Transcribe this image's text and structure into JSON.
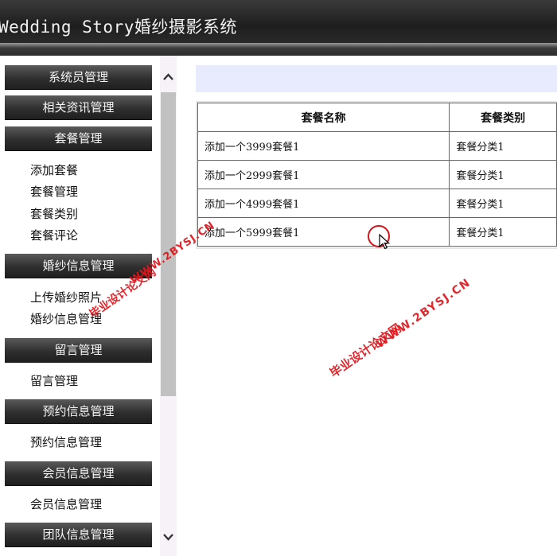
{
  "header": {
    "title": "Wedding Story婚纱摄影系统"
  },
  "sidebar": {
    "menus": [
      {
        "label": "系统员管理",
        "items": []
      },
      {
        "label": "相关资讯管理",
        "items": []
      },
      {
        "label": "套餐管理",
        "items": [
          "添加套餐",
          "套餐管理",
          "套餐类别",
          "套餐评论"
        ]
      },
      {
        "label": "婚纱信息管理",
        "items": [
          "上传婚纱照片",
          "婚纱信息管理"
        ]
      },
      {
        "label": "留言管理",
        "items": [
          "留言管理"
        ]
      },
      {
        "label": "预约信息管理",
        "items": [
          "预约信息管理"
        ]
      },
      {
        "label": "会员信息管理",
        "items": [
          "会员信息管理"
        ]
      },
      {
        "label": "团队信息管理",
        "items": []
      }
    ]
  },
  "table": {
    "headers": [
      "套餐名称",
      "套餐类别"
    ],
    "rows": [
      [
        "添加一个3999套餐1",
        "套餐分类1"
      ],
      [
        "添加一个2999套餐1",
        "套餐分类1"
      ],
      [
        "添加一个4999套餐1",
        "套餐分类1"
      ],
      [
        "添加一个5999套餐1",
        "套餐分类1"
      ]
    ]
  },
  "watermark": {
    "line1": "毕业设计论文网",
    "line2": "WWW.2BYSJ.CN"
  },
  "colors": {
    "header": "#2a2a2a",
    "info_bar": "#e8ebfd",
    "watermark": "#e0151b"
  }
}
